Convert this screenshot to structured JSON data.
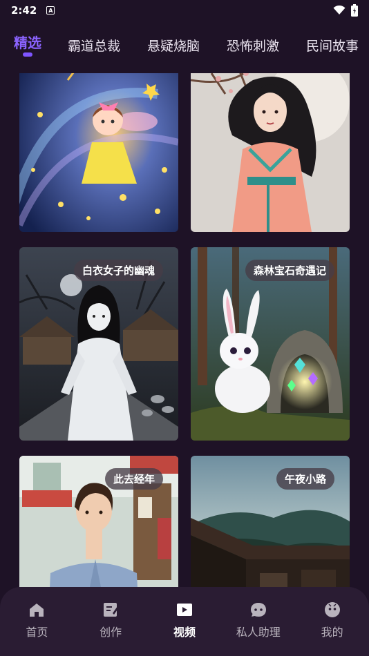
{
  "status": {
    "time": "2:42",
    "notif_icon": "A"
  },
  "tabs": [
    {
      "label": "精选",
      "active": true
    },
    {
      "label": "霸道总裁"
    },
    {
      "label": "悬疑烧脑"
    },
    {
      "label": "恐怖刺激"
    },
    {
      "label": "民间故事"
    }
  ],
  "cards": [
    {
      "label": ""
    },
    {
      "label": ""
    },
    {
      "label": "白衣女子的幽魂"
    },
    {
      "label": "森林宝石奇遇记"
    },
    {
      "label": "此去经年"
    },
    {
      "label": "午夜小路"
    }
  ],
  "nav": [
    {
      "label": "首页",
      "icon": "home-icon"
    },
    {
      "label": "创作",
      "icon": "edit-icon"
    },
    {
      "label": "视频",
      "icon": "video-icon",
      "active": true
    },
    {
      "label": "私人助理",
      "icon": "chat-icon"
    },
    {
      "label": "我的",
      "icon": "profile-icon"
    }
  ],
  "colors": {
    "accent": "#7e55ff",
    "background": "#1e1226",
    "nav_bg": "#2a1c33"
  }
}
